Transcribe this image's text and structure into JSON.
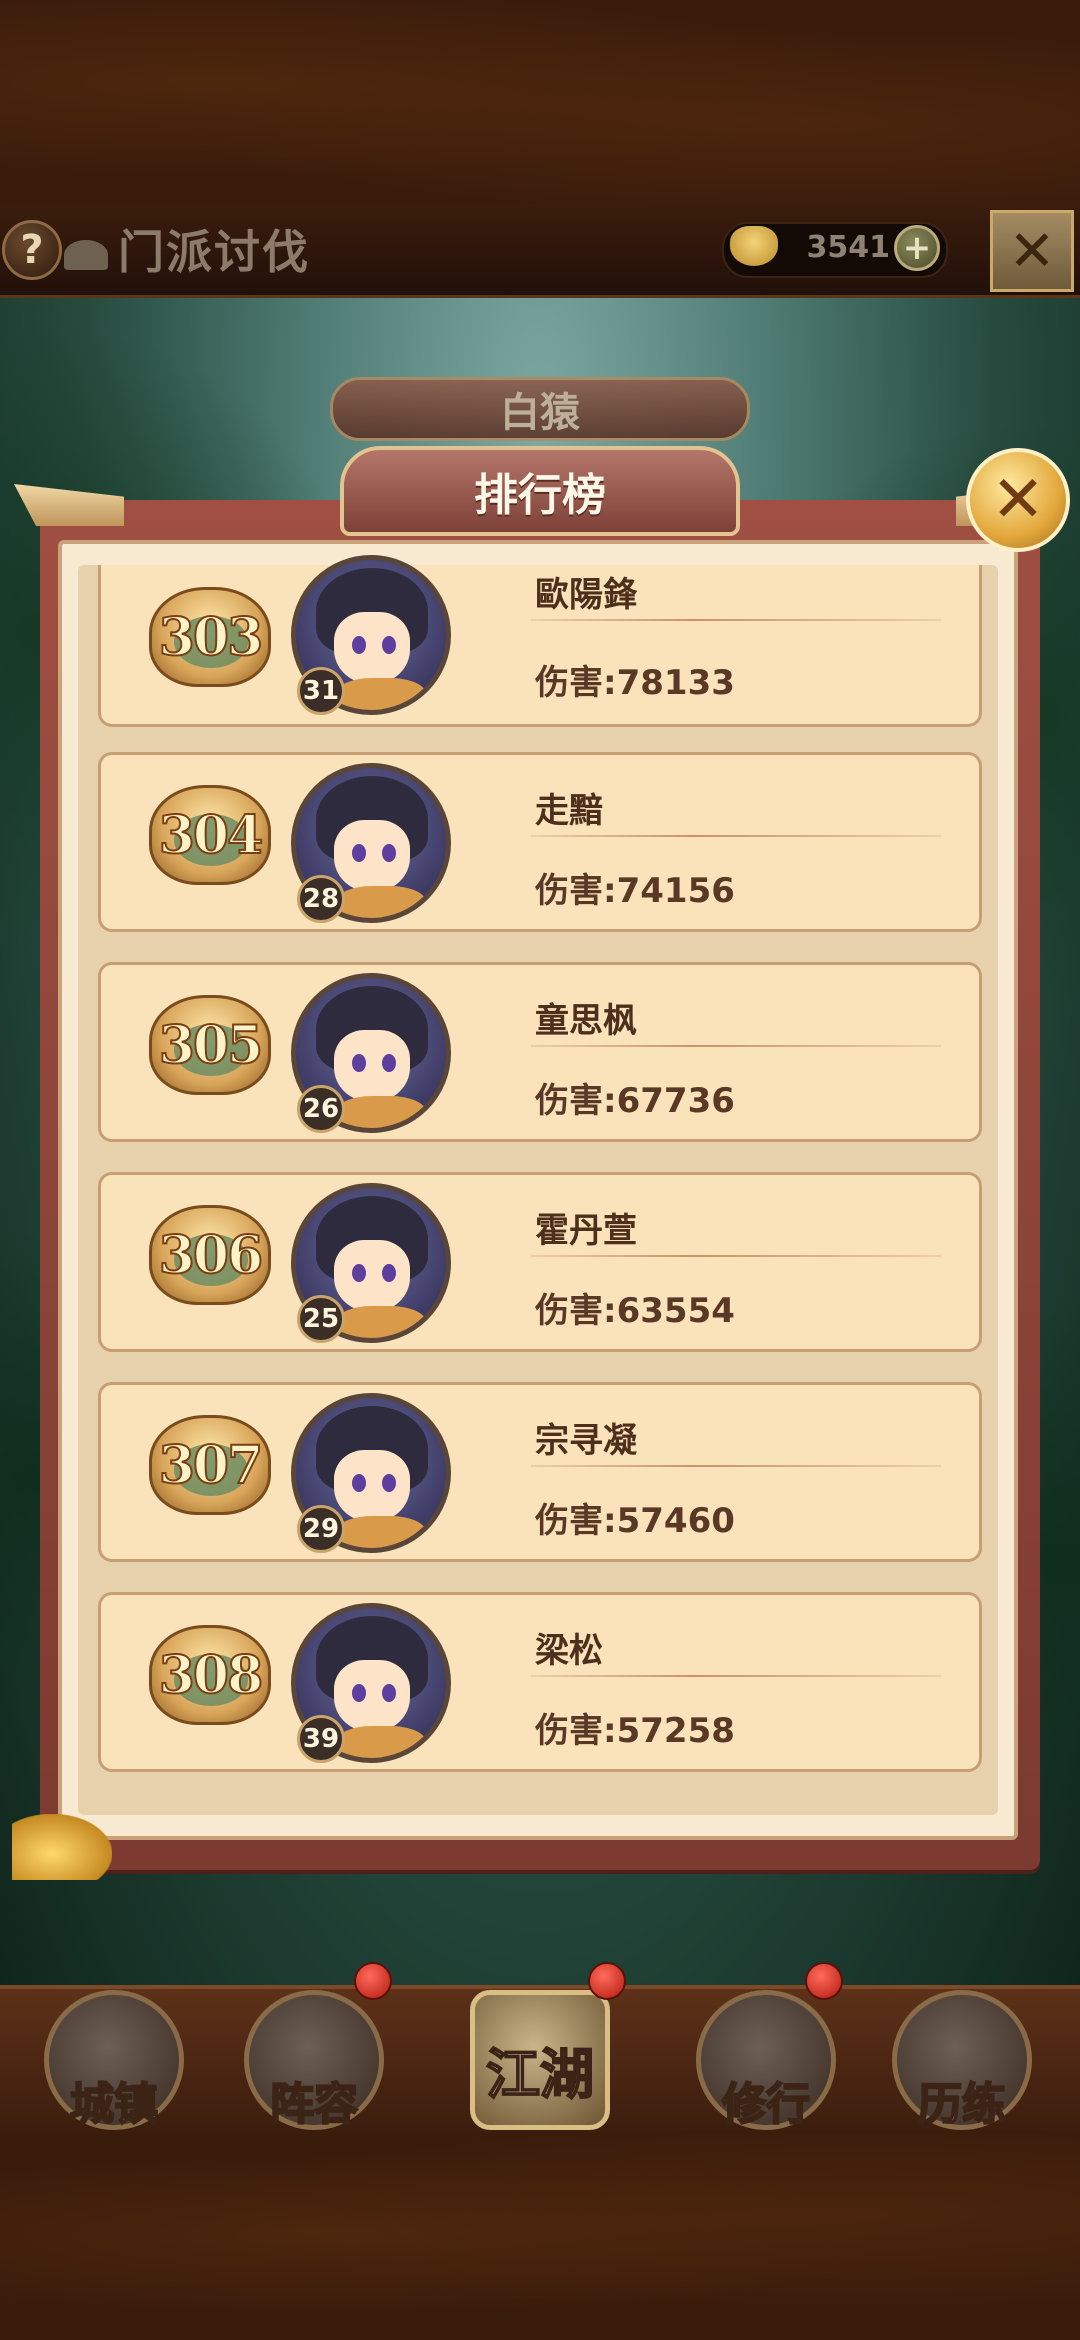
{
  "header": {
    "title": "门派讨伐",
    "currency_value": "3541",
    "help_label": "?",
    "plus_label": "+"
  },
  "boss_tab": "白猿",
  "ranking": {
    "title": "排行榜",
    "rows": [
      {
        "rank": "303",
        "level": "31",
        "name": "歐陽鋒",
        "damage": "伤害:78133"
      },
      {
        "rank": "304",
        "level": "28",
        "name": "走黯",
        "damage": "伤害:74156"
      },
      {
        "rank": "305",
        "level": "26",
        "name": "童思枫",
        "damage": "伤害:67736"
      },
      {
        "rank": "306",
        "level": "25",
        "name": "霍丹萱",
        "damage": "伤害:63554"
      },
      {
        "rank": "307",
        "level": "29",
        "name": "宗寻凝",
        "damage": "伤害:57460"
      },
      {
        "rank": "308",
        "level": "39",
        "name": "梁松",
        "damage": "伤害:57258"
      }
    ]
  },
  "nav": [
    {
      "label": "城镇",
      "icon": "town-icon"
    },
    {
      "label": "阵容",
      "icon": "lineup-icon"
    },
    {
      "label": "江湖",
      "icon": "jianghu-icon"
    },
    {
      "label": "修行",
      "icon": "cultivate-icon"
    },
    {
      "label": "历练",
      "icon": "training-icon"
    }
  ],
  "colors": {
    "row_bg": "#fae3ba",
    "panel_frame": "#a04f42",
    "badge_gold": "#d8a55a",
    "notification_red": "#d0281a"
  }
}
